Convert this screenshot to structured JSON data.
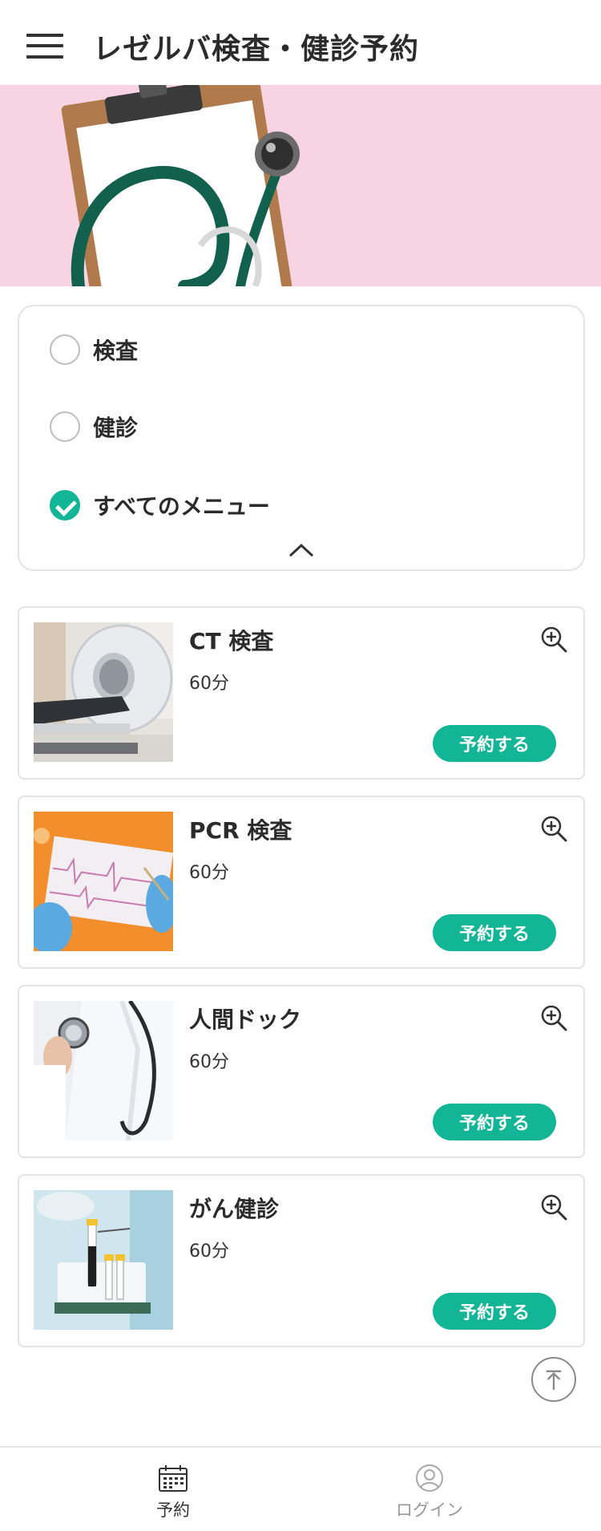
{
  "header": {
    "title": "レゼルバ検査・健診予約",
    "menu_icon": "hamburger-menu-icon"
  },
  "hero": {
    "image": "clipboard-and-stethoscope-photo",
    "background_color": "#f8d3e2"
  },
  "filter": {
    "options": [
      {
        "label": "検査",
        "checked": false
      },
      {
        "label": "健診",
        "checked": false
      },
      {
        "label": "すべてのメニュー",
        "checked": true
      }
    ],
    "collapse_icon": "chevron-up-icon"
  },
  "menu_items": [
    {
      "title": "CT 検査",
      "duration": "60分",
      "button_label": "予約する",
      "image": "ct-scanner-photo"
    },
    {
      "title": "PCR 検査",
      "duration": "60分",
      "button_label": "予約する",
      "image": "gloved-hands-ecg-chart-photo"
    },
    {
      "title": "人間ドック",
      "duration": "60分",
      "button_label": "予約する",
      "image": "doctor-with-stethoscope-photo"
    },
    {
      "title": "がん健診",
      "duration": "60分",
      "button_label": "予約する",
      "image": "blood-sample-tubes-photo"
    }
  ],
  "scroll_top_icon": "arrow-up-to-top-icon",
  "bottom_nav": {
    "items": [
      {
        "label": "予約",
        "icon": "calendar-icon",
        "active": true
      },
      {
        "label": "ログイン",
        "icon": "user-avatar-icon",
        "active": false
      }
    ]
  },
  "colors": {
    "accent": "#12b596",
    "text": "#2b2b2b",
    "border": "#e3e3e3",
    "inactive_nav": "#999999"
  }
}
